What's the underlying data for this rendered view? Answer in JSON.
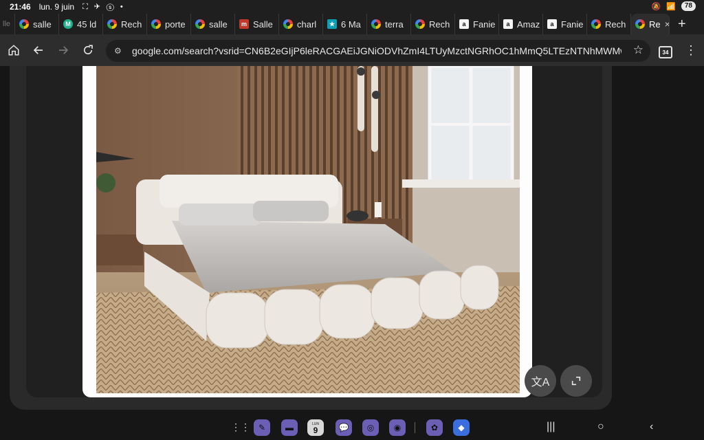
{
  "status": {
    "time": "21:46",
    "date": "lun. 9 juin",
    "icons": "⛶ ✈ ⓢ •",
    "battery": "78"
  },
  "tabs": [
    {
      "label": "salle",
      "fav": "g"
    },
    {
      "label": "45 ld",
      "fav": "m"
    },
    {
      "label": "Rech",
      "fav": "g"
    },
    {
      "label": "porte",
      "fav": "g"
    },
    {
      "label": "salle",
      "fav": "g"
    },
    {
      "label": "Salle",
      "fav": "red"
    },
    {
      "label": "charl",
      "fav": "g"
    },
    {
      "label": "6 Ma",
      "fav": "star"
    },
    {
      "label": "terra",
      "fav": "g"
    },
    {
      "label": "Rech",
      "fav": "g"
    },
    {
      "label": "Fanie",
      "fav": "amz"
    },
    {
      "label": "Amaz",
      "fav": "amz"
    },
    {
      "label": "Fanie",
      "fav": "amz"
    },
    {
      "label": "Rech",
      "fav": "g"
    },
    {
      "label": "Re",
      "fav": "g",
      "active": true
    }
  ],
  "toolbar": {
    "url": "google.com/search?vsrid=CN6B2eGIjP6leRACGAEiJGNiODVhZmI4LTUyMzctNGRhOC1hMmQ5LTEzNTNhMWMwN",
    "tab_count": "34"
  },
  "overlay_buttons": {
    "translate_icon": "translate-icon",
    "expand_icon": "expand-icon"
  },
  "dock": {
    "calendar_day": "9",
    "calendar_label": "LUN"
  },
  "colors": {
    "accent": "#6a5fb5",
    "chrome": "#2d2d2d",
    "omnibox": "#1f1f1f"
  }
}
